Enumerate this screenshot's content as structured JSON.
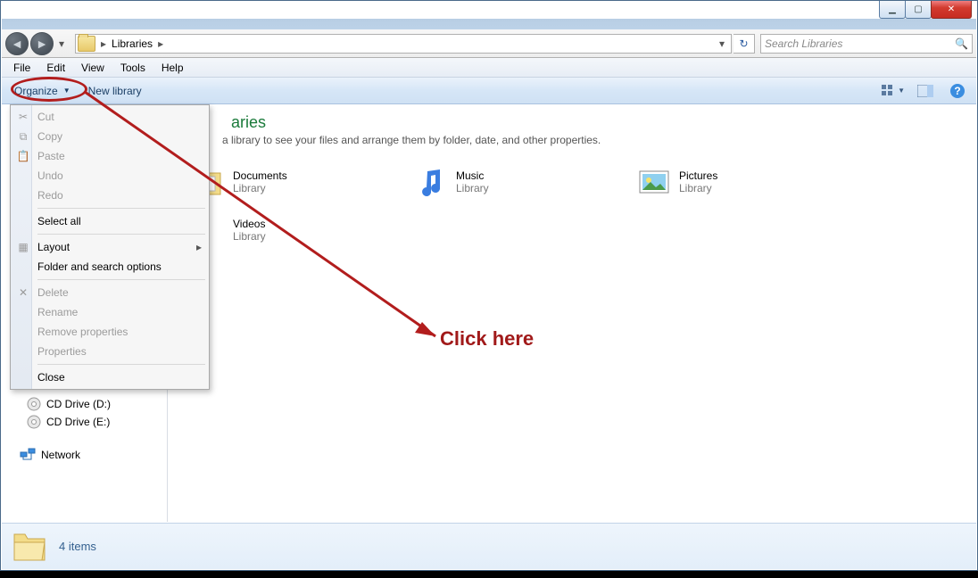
{
  "window_controls": {
    "min": "▁",
    "max": "▢",
    "close": "✕"
  },
  "nav": {
    "breadcrumb_root": "Libraries",
    "breadcrumb_sep": "▸",
    "search_placeholder": "Search Libraries"
  },
  "menubar": {
    "file": "File",
    "edit": "Edit",
    "view": "View",
    "tools": "Tools",
    "help": "Help"
  },
  "cmdbar": {
    "organize": "Organize",
    "new_library": "New library"
  },
  "organize_menu": {
    "cut": "Cut",
    "copy": "Copy",
    "paste": "Paste",
    "undo": "Undo",
    "redo": "Redo",
    "select_all": "Select all",
    "layout": "Layout",
    "folder_options": "Folder and search options",
    "delete": "Delete",
    "rename": "Rename",
    "remove_props": "Remove properties",
    "properties": "Properties",
    "close": "Close"
  },
  "content": {
    "title_suffix": "aries",
    "subtitle_suffix": "a library to see your files and arrange them by folder, date, and other properties.",
    "library_label": "Library",
    "libs": {
      "documents": "Documents",
      "music": "Music",
      "pictures": "Pictures",
      "videos": "Videos"
    }
  },
  "sidebar": {
    "cd_d": "CD Drive (D:)",
    "cd_e": "CD Drive (E:)",
    "network": "Network"
  },
  "status": {
    "count": "4 items"
  },
  "annotation": {
    "label": "Click here"
  }
}
